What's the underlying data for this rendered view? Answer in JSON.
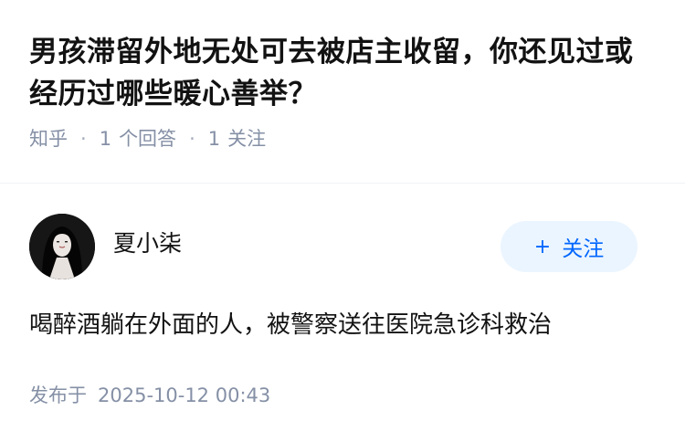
{
  "question": {
    "title": "男孩滞留外地无处可去被店主收留，你还见过或经历过哪些暖心善举？",
    "source": "知乎",
    "answer_count": "1",
    "answer_label": "个回答",
    "follow_count": "1",
    "follow_label": "关注"
  },
  "answer": {
    "author_name": "夏小柒",
    "follow_button": {
      "icon": "+",
      "label": "关注"
    },
    "content": "喝醉酒躺在外面的人，被警察送往医院急诊科救治",
    "published_label": "发布于",
    "published_time": "2025-10-12 00:43"
  },
  "colors": {
    "text": "#121212",
    "meta": "#8590a6",
    "accent": "#0066ff",
    "accent_bg": "#ebf5ff"
  }
}
